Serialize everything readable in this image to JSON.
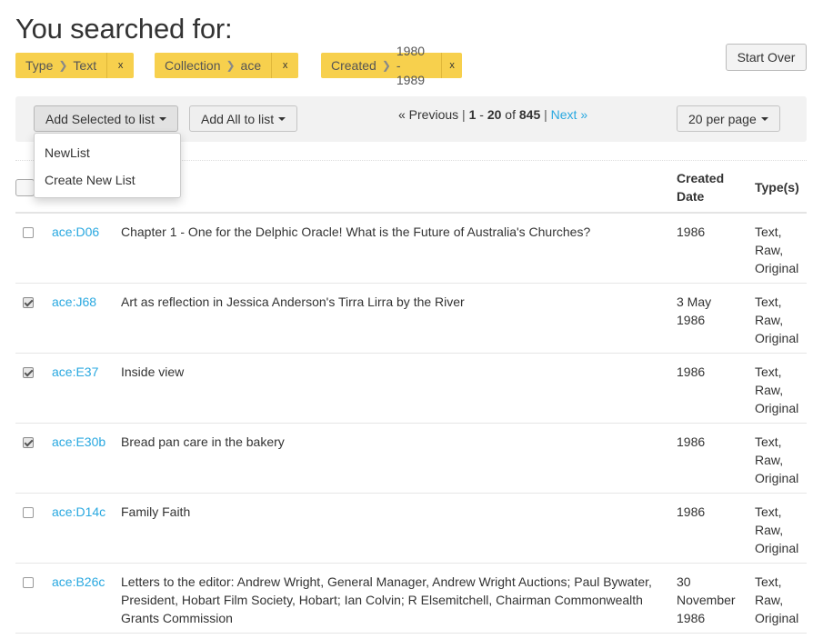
{
  "page": {
    "title": "You searched for:"
  },
  "constraints": [
    {
      "field": "Type",
      "value": "Text",
      "remove": "x"
    },
    {
      "field": "Collection",
      "value": "ace",
      "remove": "x"
    },
    {
      "field": "Created",
      "value": "1980 - 1989",
      "remove": "x"
    }
  ],
  "start_over_label": "Start Over",
  "toolbar": {
    "add_selected_label": "Add Selected to list",
    "add_all_label": "Add All to list",
    "per_page_label": "20 per page"
  },
  "pager": {
    "previous": "« Previous",
    "separator": "|",
    "range_start": "1",
    "dash": "-",
    "range_end": "20",
    "of": "of",
    "total": "845",
    "next": "Next »"
  },
  "dropdown": {
    "items": [
      "NewList",
      "Create New List"
    ]
  },
  "table": {
    "col_created_line1": "Created",
    "col_created_line2": "Date",
    "col_types": "Type(s)",
    "rows": [
      {
        "checked": false,
        "id": "ace:D06",
        "title": "Chapter 1 - One for the Delphic Oracle! What is the Future of Australia's Churches?",
        "date": "1986",
        "types": [
          "Text,",
          "Raw,",
          "Original"
        ]
      },
      {
        "checked": true,
        "id": "ace:J68",
        "title": "Art as reflection in Jessica Anderson's Tirra Lirra by the River",
        "date": "3 May 1986",
        "types": [
          "Text,",
          "Raw,",
          "Original"
        ]
      },
      {
        "checked": true,
        "id": "ace:E37",
        "title": "Inside view",
        "date": "1986",
        "types": [
          "Text,",
          "Raw,",
          "Original"
        ]
      },
      {
        "checked": true,
        "id": "ace:E30b",
        "title": "Bread pan care in the bakery",
        "date": "1986",
        "types": [
          "Text,",
          "Raw,",
          "Original"
        ]
      },
      {
        "checked": false,
        "id": "ace:D14c",
        "title": "Family Faith",
        "date": "1986",
        "types": [
          "Text,",
          "Raw,",
          "Original"
        ]
      },
      {
        "checked": false,
        "id": "ace:B26c",
        "title": "Letters to the editor: Andrew Wright, General Manager, Andrew Wright Auctions; Paul Bywater, President, Hobart Film Society, Hobart; Ian Colvin; R Elsemitchell, Chairman Commonwealth Grants Commission",
        "date": "30 November 1986",
        "types": [
          "Text,",
          "Raw,",
          "Original"
        ]
      }
    ]
  }
}
